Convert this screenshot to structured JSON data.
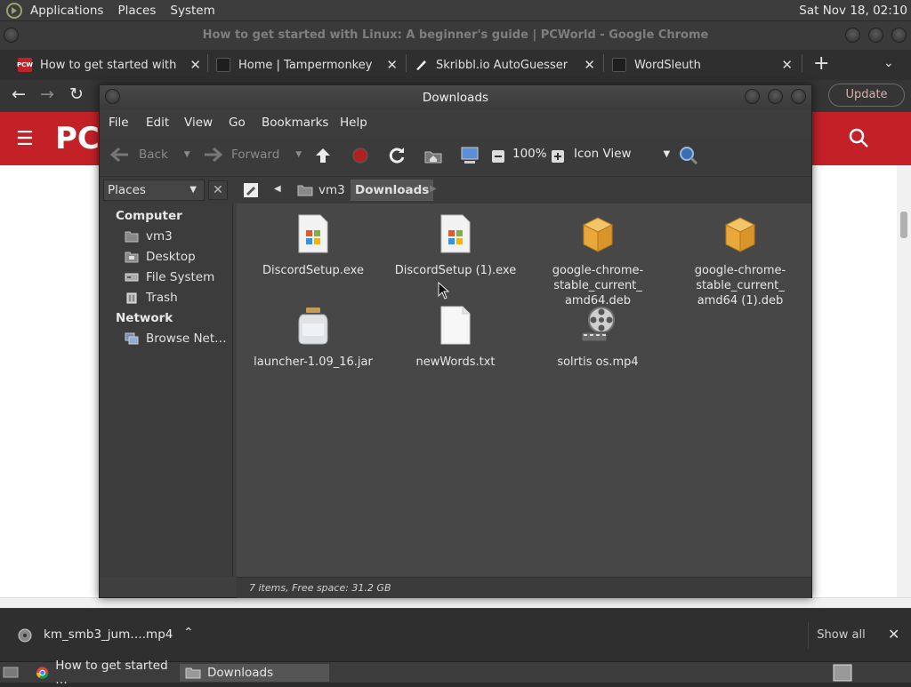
{
  "top_panel": {
    "menus": [
      "Applications",
      "Places",
      "System"
    ],
    "clock": "Sat Nov 18, 02:10"
  },
  "chrome": {
    "window_title": "How to get started with Linux: A beginner's guide | PCWorld - Google Chrome",
    "tabs": [
      {
        "label": "How to get started with Lin",
        "favicon": "pcw-favicon"
      },
      {
        "label": "Home | Tampermonkey",
        "favicon": "tampermonkey-favicon"
      },
      {
        "label": "Skribbl.io AutoGuesser",
        "favicon": "skribbl-favicon"
      },
      {
        "label": "WordSleuth",
        "favicon": "wordsleuth-favicon"
      }
    ],
    "update_label": "Update",
    "page_logo": "PCW"
  },
  "file_manager": {
    "title": "Downloads",
    "menus": [
      "File",
      "Edit",
      "View",
      "Go",
      "Bookmarks",
      "Help"
    ],
    "toolbar": {
      "back": "Back",
      "forward": "Forward",
      "zoom": "100%",
      "view_mode": "Icon View"
    },
    "sidebar_combo": "Places",
    "breadcrumbs": [
      "vm3",
      "Downloads"
    ],
    "sidebar": {
      "computer_heading": "Computer",
      "computer_items": [
        "vm3",
        "Desktop",
        "File System",
        "Trash"
      ],
      "network_heading": "Network",
      "network_items": [
        "Browse Net…"
      ]
    },
    "files": [
      {
        "name": "DiscordSetup.exe",
        "icon": "exe-icon"
      },
      {
        "name": "DiscordSetup (1).exe",
        "icon": "exe-icon"
      },
      {
        "name": "google-chrome-stable_current_amd64.deb",
        "lines": [
          "google-chrome-",
          "stable_current_",
          "amd64.deb"
        ],
        "icon": "package-icon"
      },
      {
        "name": "google-chrome-stable_current_amd64 (1).deb",
        "lines": [
          "google-chrome-",
          "stable_current_",
          "amd64 (1).deb"
        ],
        "icon": "package-icon"
      },
      {
        "name": "launcher-1.09_16.jar",
        "icon": "jar-icon"
      },
      {
        "name": "newWords.txt",
        "icon": "text-file-icon"
      },
      {
        "name": "solrtis os.mp4",
        "icon": "video-icon"
      }
    ],
    "status": "7 items, Free space: 31.2 GB"
  },
  "download_bar": {
    "file": "km_smb3_jum….mp4",
    "show_all": "Show all"
  },
  "taskbar": {
    "tasks": [
      "How to get started …",
      "Downloads"
    ]
  },
  "colors": {
    "pcw_red": "#c32127",
    "package_orange": "#e8a83a"
  }
}
